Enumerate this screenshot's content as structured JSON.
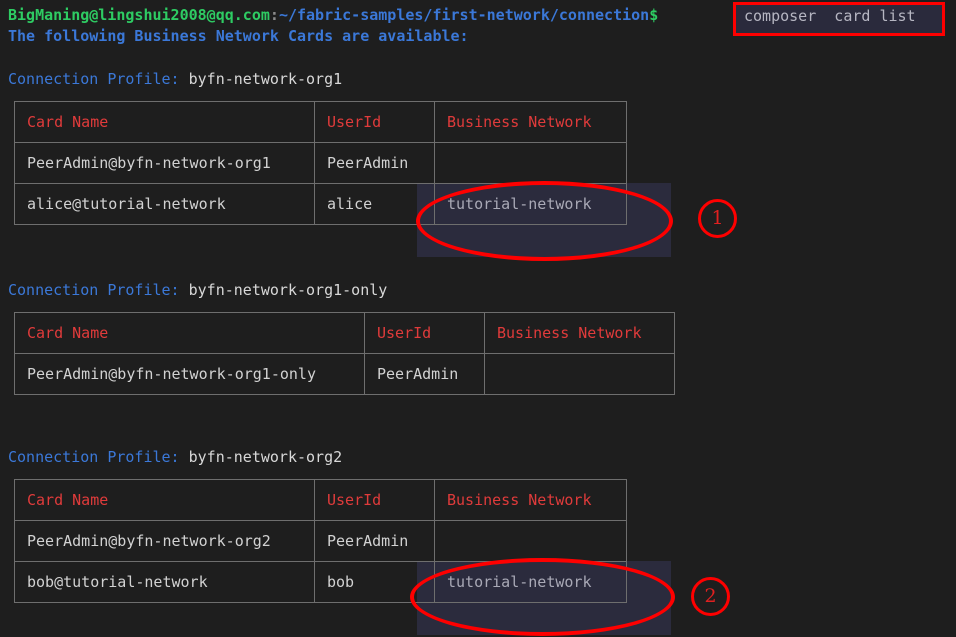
{
  "terminal": {
    "background": "#1e1e1e",
    "prompt": {
      "user_host": "BigManing@lingshui2008@qq.com",
      "separator": ":",
      "path": "~/fabric-samples/first-network/connection",
      "sigil": "$"
    },
    "command": "composer  card list",
    "output_message": "The following Business Network Cards are available:"
  },
  "sections": [
    {
      "profile_label": "Connection Profile:",
      "profile_name": "byfn-network-org1",
      "headers": [
        "Card Name",
        "UserId",
        "Business Network"
      ],
      "rows": [
        {
          "card_name": "PeerAdmin@byfn-network-org1",
          "user_id": "PeerAdmin",
          "business_network": ""
        },
        {
          "card_name": "alice@tutorial-network",
          "user_id": "alice",
          "business_network": "tutorial-network"
        }
      ]
    },
    {
      "profile_label": "Connection Profile:",
      "profile_name": "byfn-network-org1-only",
      "headers": [
        "Card Name",
        "UserId",
        "Business Network"
      ],
      "rows": [
        {
          "card_name": "PeerAdmin@byfn-network-org1-only",
          "user_id": "PeerAdmin",
          "business_network": ""
        }
      ]
    },
    {
      "profile_label": "Connection Profile:",
      "profile_name": "byfn-network-org2",
      "headers": [
        "Card Name",
        "UserId",
        "Business Network"
      ],
      "rows": [
        {
          "card_name": "PeerAdmin@byfn-network-org2",
          "user_id": "PeerAdmin",
          "business_network": ""
        },
        {
          "card_name": "bob@tutorial-network",
          "user_id": "bob",
          "business_network": "tutorial-network"
        }
      ]
    }
  ],
  "annotations": {
    "color": "#fe0000",
    "badges": [
      {
        "label": "1"
      },
      {
        "label": "2"
      }
    ]
  }
}
